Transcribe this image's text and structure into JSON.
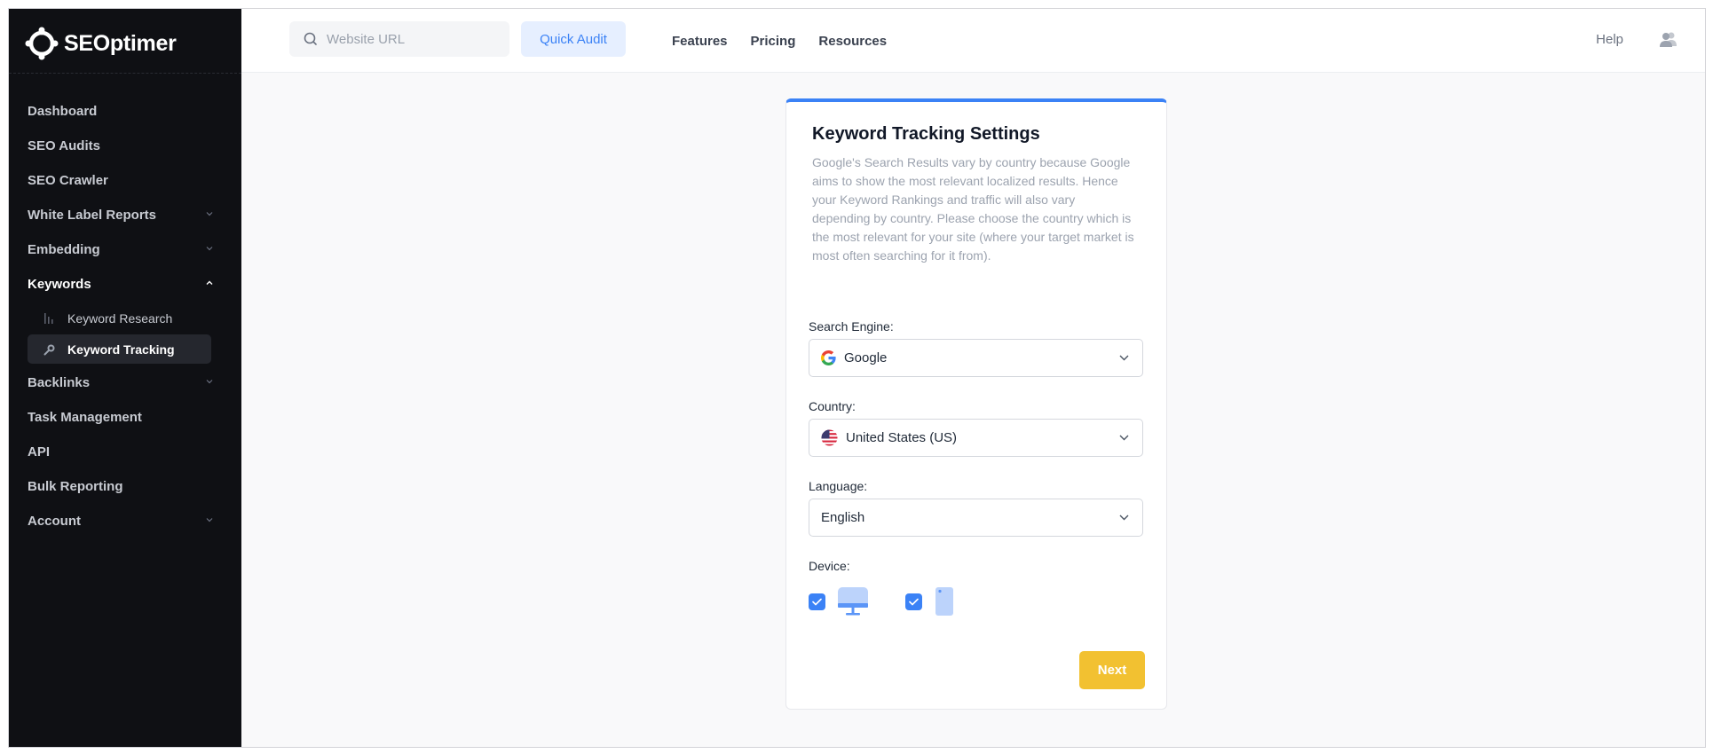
{
  "brand": {
    "name": "SEOptimer",
    "logo_icon": "seoptimer-logo-icon"
  },
  "sidebar": {
    "items": [
      {
        "label": "Dashboard",
        "expandable": false
      },
      {
        "label": "SEO Audits",
        "expandable": false
      },
      {
        "label": "SEO Crawler",
        "expandable": false
      },
      {
        "label": "White Label Reports",
        "expandable": true
      },
      {
        "label": "Embedding",
        "expandable": true
      },
      {
        "label": "Keywords",
        "expandable": true,
        "expanded": true
      },
      {
        "label": "Backlinks",
        "expandable": true
      },
      {
        "label": "Task Management",
        "expandable": false
      },
      {
        "label": "API",
        "expandable": false
      },
      {
        "label": "Bulk Reporting",
        "expandable": false
      },
      {
        "label": "Account",
        "expandable": true
      }
    ],
    "keywords_sub": [
      {
        "label": "Keyword Research",
        "icon": "bar-chart-icon"
      },
      {
        "label": "Keyword Tracking",
        "icon": "magnifier-icon",
        "active": true
      }
    ]
  },
  "topbar": {
    "search_placeholder": "Website URL",
    "quick_audit_label": "Quick Audit",
    "nav": [
      "Features",
      "Pricing",
      "Resources"
    ],
    "help_label": "Help"
  },
  "settings": {
    "title": "Keyword Tracking Settings",
    "description": "Google's Search Results vary by country because Google aims to show the most relevant localized results. Hence your Keyword Rankings and traffic will also vary depending by country. Please choose the country which is the most relevant for your site (where your target market is most often searching for it from).",
    "search_engine_label": "Search Engine:",
    "search_engine_value": "Google",
    "country_label": "Country:",
    "country_value": "United States (US)",
    "language_label": "Language:",
    "language_value": "English",
    "device_label": "Device:",
    "devices": [
      {
        "icon": "desktop-icon",
        "checked": true
      },
      {
        "icon": "mobile-icon",
        "checked": true
      }
    ],
    "next_label": "Next"
  },
  "colors": {
    "sidebar_bg": "#0f1014",
    "accent": "#3b82f6",
    "next_button": "#f2c131",
    "quick_audit_bg": "#e6efff"
  }
}
